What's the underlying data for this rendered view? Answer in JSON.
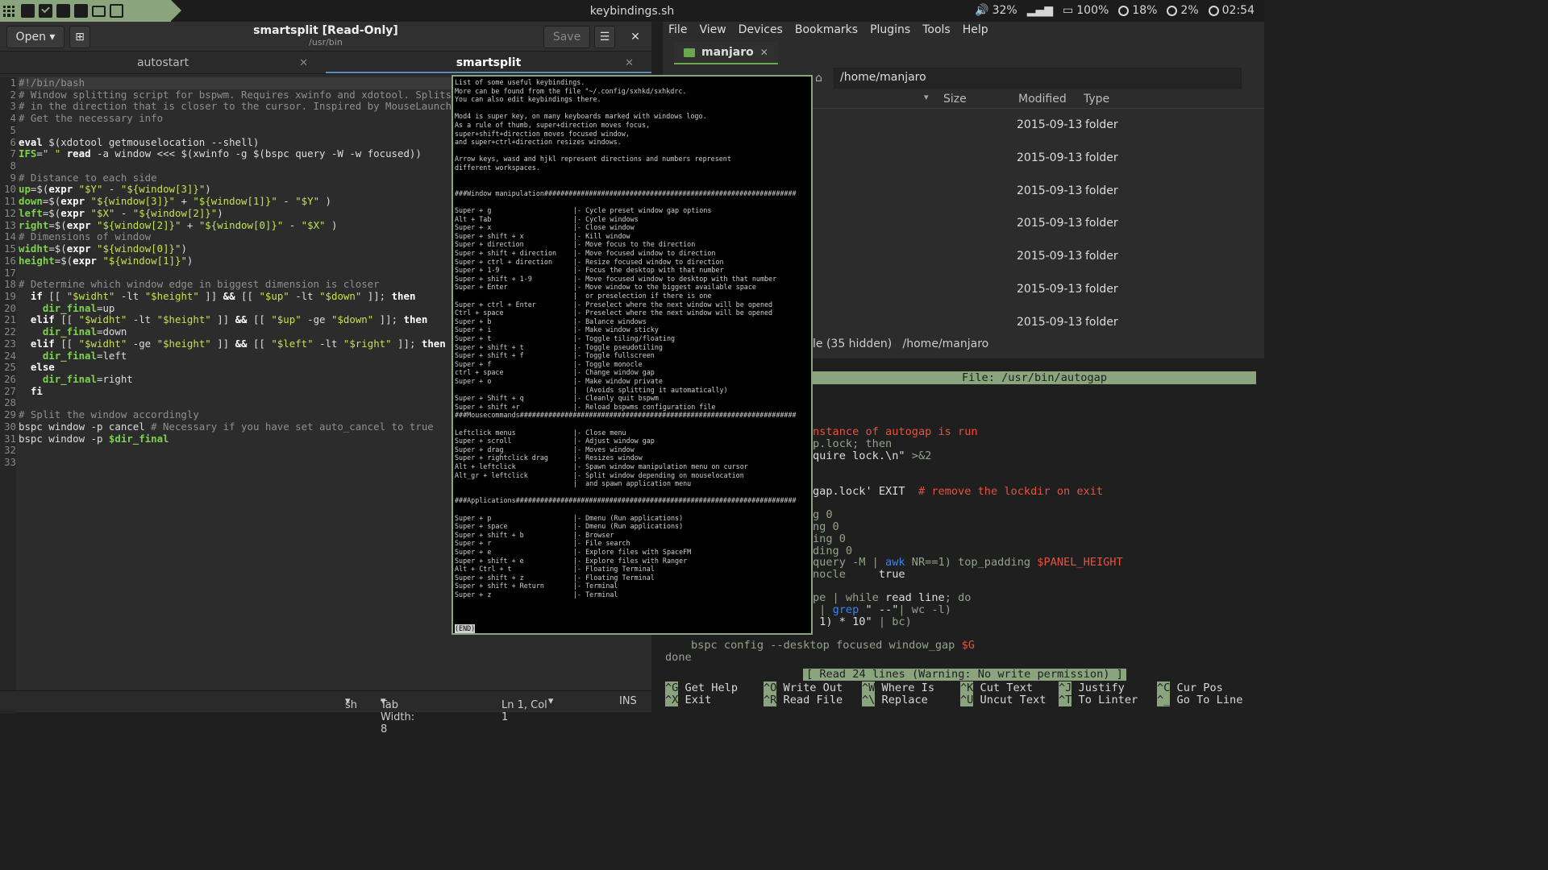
{
  "topbar": {
    "title": "keybindings.sh",
    "volume": "32%",
    "battery": "100%",
    "cpu": "18%",
    "mem": "2%",
    "clock": "02:54"
  },
  "gedit": {
    "open_label": "Open",
    "title": "smartsplit [Read-Only]",
    "subtitle": "/usr/bin",
    "save_label": "Save",
    "tabs": [
      "autostart",
      "smartsplit"
    ],
    "code": [
      [
        [
          "cm",
          "#!/bin/bash"
        ]
      ],
      [
        [
          "cm",
          "# Window splitting script for bspwm. Requires xwinfo and xdotool. Splits"
        ]
      ],
      [
        [
          "cm",
          "# in the direction that is closer to the cursor. Inspired by MouseLaunch"
        ]
      ],
      [
        [
          "cm",
          "# Get the necessary info"
        ]
      ],
      [],
      [
        [
          "kw",
          "eval"
        ],
        [
          "op",
          " $(xdotool getmouselocation --shell)"
        ]
      ],
      [
        [
          "vr",
          "IFS"
        ],
        [
          "op",
          "="
        ],
        [
          "st",
          "\" \""
        ],
        [
          "op",
          " "
        ],
        [
          "kw",
          "read"
        ],
        [
          "op",
          " -a window <<< $(xwinfo -g $(bspc query -W -w focused))"
        ]
      ],
      [],
      [
        [
          "cm",
          "# Distance to each side"
        ]
      ],
      [
        [
          "vr",
          "up"
        ],
        [
          "op",
          "=$("
        ],
        [
          "kw",
          "expr"
        ],
        [
          "op",
          " "
        ],
        [
          "st",
          "\"$Y\""
        ],
        [
          "op",
          " - "
        ],
        [
          "st",
          "\"${window[3]}\""
        ],
        [
          "op",
          ")"
        ]
      ],
      [
        [
          "vr",
          "down"
        ],
        [
          "op",
          "=$("
        ],
        [
          "kw",
          "expr"
        ],
        [
          "op",
          " "
        ],
        [
          "st",
          "\"${window[3]}\""
        ],
        [
          "op",
          " + "
        ],
        [
          "st",
          "\"${window[1]}\""
        ],
        [
          "op",
          " - "
        ],
        [
          "st",
          "\"$Y\""
        ],
        [
          "op",
          " )"
        ]
      ],
      [
        [
          "vr",
          "left"
        ],
        [
          "op",
          "=$("
        ],
        [
          "kw",
          "expr"
        ],
        [
          "op",
          " "
        ],
        [
          "st",
          "\"$X\""
        ],
        [
          "op",
          " - "
        ],
        [
          "st",
          "\"${window[2]}\""
        ],
        [
          "op",
          ")"
        ]
      ],
      [
        [
          "vr",
          "right"
        ],
        [
          "op",
          "=$("
        ],
        [
          "kw",
          "expr"
        ],
        [
          "op",
          " "
        ],
        [
          "st",
          "\"${window[2]}\""
        ],
        [
          "op",
          " + "
        ],
        [
          "st",
          "\"${window[0]}\""
        ],
        [
          "op",
          " - "
        ],
        [
          "st",
          "\"$X\""
        ],
        [
          "op",
          " )"
        ]
      ],
      [
        [
          "cm",
          "# Dimensions of window"
        ]
      ],
      [
        [
          "vr",
          "widht"
        ],
        [
          "op",
          "=$("
        ],
        [
          "kw",
          "expr"
        ],
        [
          "op",
          " "
        ],
        [
          "st",
          "\"${window[0]}\""
        ],
        [
          "op",
          ")"
        ]
      ],
      [
        [
          "vr",
          "height"
        ],
        [
          "op",
          "=$("
        ],
        [
          "kw",
          "expr"
        ],
        [
          "op",
          " "
        ],
        [
          "st",
          "\"${window[1]}\""
        ],
        [
          "op",
          ")"
        ]
      ],
      [],
      [
        [
          "cm",
          "# Determine which window edge in biggest dimension is closer"
        ]
      ],
      [
        [
          "op",
          "  "
        ],
        [
          "kw",
          "if"
        ],
        [
          "op",
          " [[ "
        ],
        [
          "st",
          "\"$widht\""
        ],
        [
          "op",
          " -lt "
        ],
        [
          "st",
          "\"$height\""
        ],
        [
          "op",
          " ]] "
        ],
        [
          "kw",
          "&&"
        ],
        [
          "op",
          " [[ "
        ],
        [
          "st",
          "\"$up\""
        ],
        [
          "op",
          " -lt "
        ],
        [
          "st",
          "\"$down\""
        ],
        [
          "op",
          " ]]; "
        ],
        [
          "kw",
          "then"
        ]
      ],
      [
        [
          "op",
          "    "
        ],
        [
          "vr",
          "dir_final"
        ],
        [
          "op",
          "=up"
        ]
      ],
      [
        [
          "op",
          "  "
        ],
        [
          "kw",
          "elif"
        ],
        [
          "op",
          " [[ "
        ],
        [
          "st",
          "\"$widht\""
        ],
        [
          "op",
          " -lt "
        ],
        [
          "st",
          "\"$height\""
        ],
        [
          "op",
          " ]] "
        ],
        [
          "kw",
          "&&"
        ],
        [
          "op",
          " [[ "
        ],
        [
          "st",
          "\"$up\""
        ],
        [
          "op",
          " -ge "
        ],
        [
          "st",
          "\"$down\""
        ],
        [
          "op",
          " ]]; "
        ],
        [
          "kw",
          "then"
        ]
      ],
      [
        [
          "op",
          "    "
        ],
        [
          "vr",
          "dir_final"
        ],
        [
          "op",
          "=down"
        ]
      ],
      [
        [
          "op",
          "  "
        ],
        [
          "kw",
          "elif"
        ],
        [
          "op",
          " [[ "
        ],
        [
          "st",
          "\"$widht\""
        ],
        [
          "op",
          " -ge "
        ],
        [
          "st",
          "\"$height\""
        ],
        [
          "op",
          " ]] "
        ],
        [
          "kw",
          "&&"
        ],
        [
          "op",
          " [[ "
        ],
        [
          "st",
          "\"$left\""
        ],
        [
          "op",
          " -lt "
        ],
        [
          "st",
          "\"$right\""
        ],
        [
          "op",
          " ]]; "
        ],
        [
          "kw",
          "then"
        ]
      ],
      [
        [
          "op",
          "    "
        ],
        [
          "vr",
          "dir_final"
        ],
        [
          "op",
          "=left"
        ]
      ],
      [
        [
          "op",
          "  "
        ],
        [
          "kw",
          "else"
        ]
      ],
      [
        [
          "op",
          "    "
        ],
        [
          "vr",
          "dir_final"
        ],
        [
          "op",
          "=right"
        ]
      ],
      [
        [
          "op",
          "  "
        ],
        [
          "kw",
          "fi"
        ]
      ],
      [],
      [
        [
          "cm",
          "# Split the window accordingly"
        ]
      ],
      [
        [
          "op",
          "bspc window -p cancel "
        ],
        [
          "cm",
          "# Necessary if you have set auto_cancel to true"
        ]
      ],
      [
        [
          "op",
          "bspc window -p "
        ],
        [
          "vr",
          "$dir_final"
        ]
      ],
      [],
      []
    ],
    "status": {
      "lang": "sh",
      "tab_width": "Tab Width: 8",
      "position": "Ln 1, Col 1",
      "mode": "INS"
    }
  },
  "spacefm": {
    "menu": [
      "File",
      "View",
      "Devices",
      "Bookmarks",
      "Plugins",
      "Tools",
      "Help"
    ],
    "tab": "manjaro",
    "path": "/home/manjaro",
    "columns": [
      "Size",
      "Modified",
      "Type"
    ],
    "rows": [
      {
        "modified": "2015-09-13",
        "type": "folder"
      },
      {
        "modified": "2015-09-13",
        "type": "folder"
      },
      {
        "modified": "2015-09-13",
        "type": "folder"
      },
      {
        "modified": "2015-09-13",
        "type": "folder"
      },
      {
        "modified": "2015-09-13",
        "type": "folder"
      },
      {
        "modified": "2015-09-13",
        "type": "folder"
      },
      {
        "modified": "2015-09-13",
        "type": "folder"
      }
    ],
    "status_hidden": "le (35 hidden)",
    "status_path": "/home/manjaro"
  },
  "nano": {
    "title": "File: /usr/bin/autogap",
    "lines": [
      {
        "t": 70,
        "l": 186,
        "parts": [
          [
            "nr",
            "nstance of autogap is run"
          ]
        ]
      },
      {
        "t": 85,
        "l": 186,
        "parts": [
          [
            "ng",
            "p.lock; then"
          ]
        ]
      },
      {
        "t": 100,
        "l": 186,
        "parts": [
          [
            "op",
            "quire lock.\\n\""
          ],
          [
            "ng",
            " >&2"
          ]
        ]
      },
      {
        "t": 144,
        "l": 186,
        "parts": [
          [
            "op",
            "gap.lock' EXIT  "
          ],
          [
            "nr",
            "# remove the lockdir on exit"
          ]
        ]
      },
      {
        "t": 173,
        "l": 186,
        "parts": [
          [
            "ng",
            "g 0"
          ]
        ]
      },
      {
        "t": 188,
        "l": 186,
        "parts": [
          [
            "ng",
            "ng 0"
          ]
        ]
      },
      {
        "t": 203,
        "l": 186,
        "parts": [
          [
            "ng",
            "ing 0"
          ]
        ]
      },
      {
        "t": 218,
        "l": 186,
        "parts": [
          [
            "ng",
            "ding 0"
          ]
        ]
      },
      {
        "t": 232,
        "l": 186,
        "parts": [
          [
            "ng",
            "query -M | "
          ],
          [
            "nb",
            "awk"
          ],
          [
            "ng",
            " NR==1) top_padding "
          ],
          [
            "nr",
            "$PANEL_HEIGHT"
          ]
        ]
      },
      {
        "t": 247,
        "l": 186,
        "parts": [
          [
            "ng",
            "nocle     "
          ],
          [
            "op",
            "true"
          ]
        ]
      },
      {
        "t": 276,
        "l": 186,
        "parts": [
          [
            "ng",
            "pe | while "
          ],
          [
            "op",
            "read line"
          ],
          [
            "ng",
            "; do"
          ]
        ]
      },
      {
        "t": 291,
        "l": 186,
        "parts": [
          [
            "ng",
            " | "
          ],
          [
            "nb",
            "grep"
          ],
          [
            "op",
            " \" --\""
          ],
          [
            "ng",
            "| wc -l)"
          ]
        ]
      },
      {
        "t": 306,
        "l": 186,
        "parts": [
          [
            "op",
            " 1) * 10\""
          ],
          [
            "ng",
            " | bc)"
          ]
        ]
      },
      {
        "t": 335,
        "l": 35,
        "parts": [
          [
            "ng",
            "bspc config --desktop focused window_gap "
          ],
          [
            "nr",
            "$G"
          ]
        ]
      },
      {
        "t": 350,
        "l": 3,
        "parts": [
          [
            "ng",
            "done"
          ]
        ]
      }
    ],
    "message": "[ Read 24 lines (Warning: No write permission) ]",
    "help": [
      {
        "k1": "^G",
        "t1": "Get Help",
        "k2": "^X",
        "t2": "Exit"
      },
      {
        "k1": "^O",
        "t1": "Write Out",
        "k2": "^R",
        "t2": "Read File"
      },
      {
        "k1": "^W",
        "t1": "Where Is",
        "k2": "^\\",
        "t2": "Replace"
      },
      {
        "k1": "^K",
        "t1": "Cut Text",
        "k2": "^U",
        "t2": "Uncut Text"
      },
      {
        "k1": "^J",
        "t1": "Justify",
        "k2": "^T",
        "t2": "To Linter"
      },
      {
        "k1": "^C",
        "t1": "Cur Pos",
        "k2": "^_",
        "t2": "Go To Line"
      }
    ]
  },
  "popup": {
    "intro": [
      "List of some useful keybindings.",
      "More can be found from the file \"~/.config/sxhkd/sxhkdrc.",
      "You can also edit keybindings there.",
      "",
      "Mod4 is super key, on many keyboards marked with windows logo.",
      "As a rule of thumb, super+direction moves focus,",
      "super+shift+direction moves focused window,",
      "and super+ctrl+direction resizes windows.",
      "",
      "Arrow keys, wasd and hjkl represent directions and numbers represent",
      "different workspaces.",
      ""
    ],
    "sections": [
      {
        "header": "###Window manipulation##############################################################",
        "rows": [
          [
            "Super + g",
            "|- Cycle preset window gap options"
          ],
          [
            "Alt + Tab",
            "|- Cycle windows"
          ],
          [
            "Super + x",
            "|- Close window"
          ],
          [
            "Super + shift + x",
            "|- Kill window"
          ],
          [
            "Super + direction",
            "|- Move focus to the direction"
          ],
          [
            "Super + shift + direction",
            "|- Move focused window to direction"
          ],
          [
            "Super + ctrl + direction",
            "|- Resize focused window to direction"
          ],
          [
            "Super + 1-9",
            "|- Focus the desktop with that number"
          ],
          [
            "Super + shift + 1-9",
            "|- Move focused window to desktop with that number"
          ],
          [
            "Super + Enter",
            "|- Move window to the biggest available space"
          ],
          [
            "",
            "|  or preselection if there is one"
          ],
          [
            "Super + ctrl + Enter",
            "|- Preselect where the next window will be opened"
          ],
          [
            "Ctrl + space",
            "|- Preselect where the next window will be opened"
          ],
          [
            "Super + b",
            "|- Balance windows"
          ],
          [
            "Super + i",
            "|- Make window sticky"
          ],
          [
            "Super + t",
            "|- Toggle tiling/floating"
          ],
          [
            "Super + shift + t",
            "|- Toggle pseudotiling"
          ],
          [
            "Super + shift + f",
            "|- Toggle fullscreen"
          ],
          [
            "Super + f",
            "|- Toggle monocle"
          ],
          [
            "ctrl + space",
            "|- Change window gap"
          ],
          [
            "Super + o",
            "|- Make window private"
          ],
          [
            "",
            "|  (Avoids splitting it automatically)"
          ],
          [
            "Super + Shift + q",
            "|- Cleanly quit bspwm"
          ],
          [
            "Super + shift +r",
            "|- Reload bspwms configuration file"
          ]
        ]
      },
      {
        "header": "###Mousecommands####################################################################",
        "rows": [
          [
            "",
            ""
          ],
          [
            "Leftclick menus",
            "|- Close menu"
          ],
          [
            "Super + scroll",
            "|- Adjust window gap"
          ],
          [
            "Super + drag",
            "|- Moves window"
          ],
          [
            "Super + rightclick drag",
            "|- Resizes window"
          ],
          [
            "Alt + leftclick",
            "|- Spawn window manipulation menu on cursor"
          ],
          [
            "Alt_gr + leftclick",
            "|- Split window depending on mouselocation"
          ],
          [
            "",
            "|  and spawn application menu"
          ],
          [
            "",
            ""
          ]
        ]
      },
      {
        "header": "###Applications#####################################################################",
        "rows": [
          [
            "",
            ""
          ],
          [
            "Super + p",
            "|- Dmenu (Run applications)"
          ],
          [
            "Super + space",
            "|- Dmenu (Run applications)"
          ],
          [
            "Super + shift + b",
            "|- Browser"
          ],
          [
            "Super + r",
            "|- File search"
          ],
          [
            "Super + e",
            "|- Explore files with SpaceFM"
          ],
          [
            "Super + shift + e",
            "|- Explore files with Ranger"
          ],
          [
            "Alt + Ctrl + t",
            "|- Floating Terminal"
          ],
          [
            "Super + shift + z",
            "|- Floating Terminal"
          ],
          [
            "Super + shift + Return",
            "|- Terminal"
          ],
          [
            "Super + z",
            "|- Terminal"
          ]
        ]
      }
    ],
    "end": "(END)"
  }
}
